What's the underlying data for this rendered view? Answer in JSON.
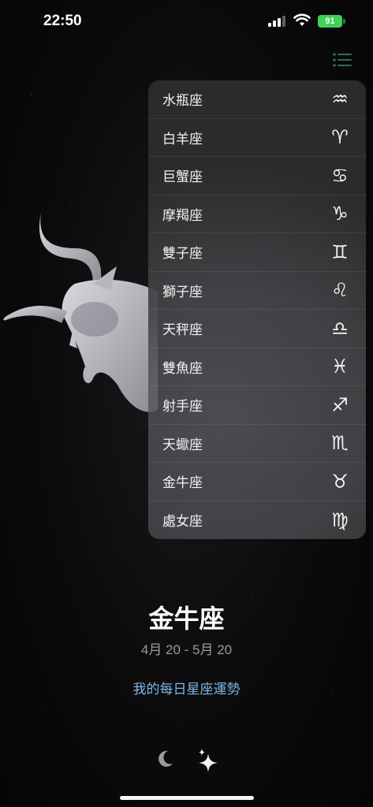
{
  "status_bar": {
    "time": "22:50",
    "battery": "91"
  },
  "menu": {
    "items": [
      {
        "label": "水瓶座",
        "symbol": "♒"
      },
      {
        "label": "白羊座",
        "symbol": "♈"
      },
      {
        "label": "巨蟹座",
        "symbol": "♋"
      },
      {
        "label": "摩羯座",
        "symbol": "♑"
      },
      {
        "label": "雙子座",
        "symbol": "♊"
      },
      {
        "label": "獅子座",
        "symbol": "♌"
      },
      {
        "label": "天秤座",
        "symbol": "♎"
      },
      {
        "label": "雙魚座",
        "symbol": "♓"
      },
      {
        "label": "射手座",
        "symbol": "♐"
      },
      {
        "label": "天蠍座",
        "symbol": "♏"
      },
      {
        "label": "金牛座",
        "symbol": "♉"
      },
      {
        "label": "處女座",
        "symbol": "♍"
      }
    ]
  },
  "sign": {
    "name": "金牛座",
    "date_range": "4月 20 - 5月 20"
  },
  "daily_link": "我的每日星座運勢",
  "icons": {
    "menu": "list-icon",
    "moon": "moon-icon",
    "sparkle": "sparkles-icon"
  },
  "colors": {
    "link": "#7fb8e6",
    "battery": "#3fd158",
    "menu_icon": "#2e6b5e"
  }
}
